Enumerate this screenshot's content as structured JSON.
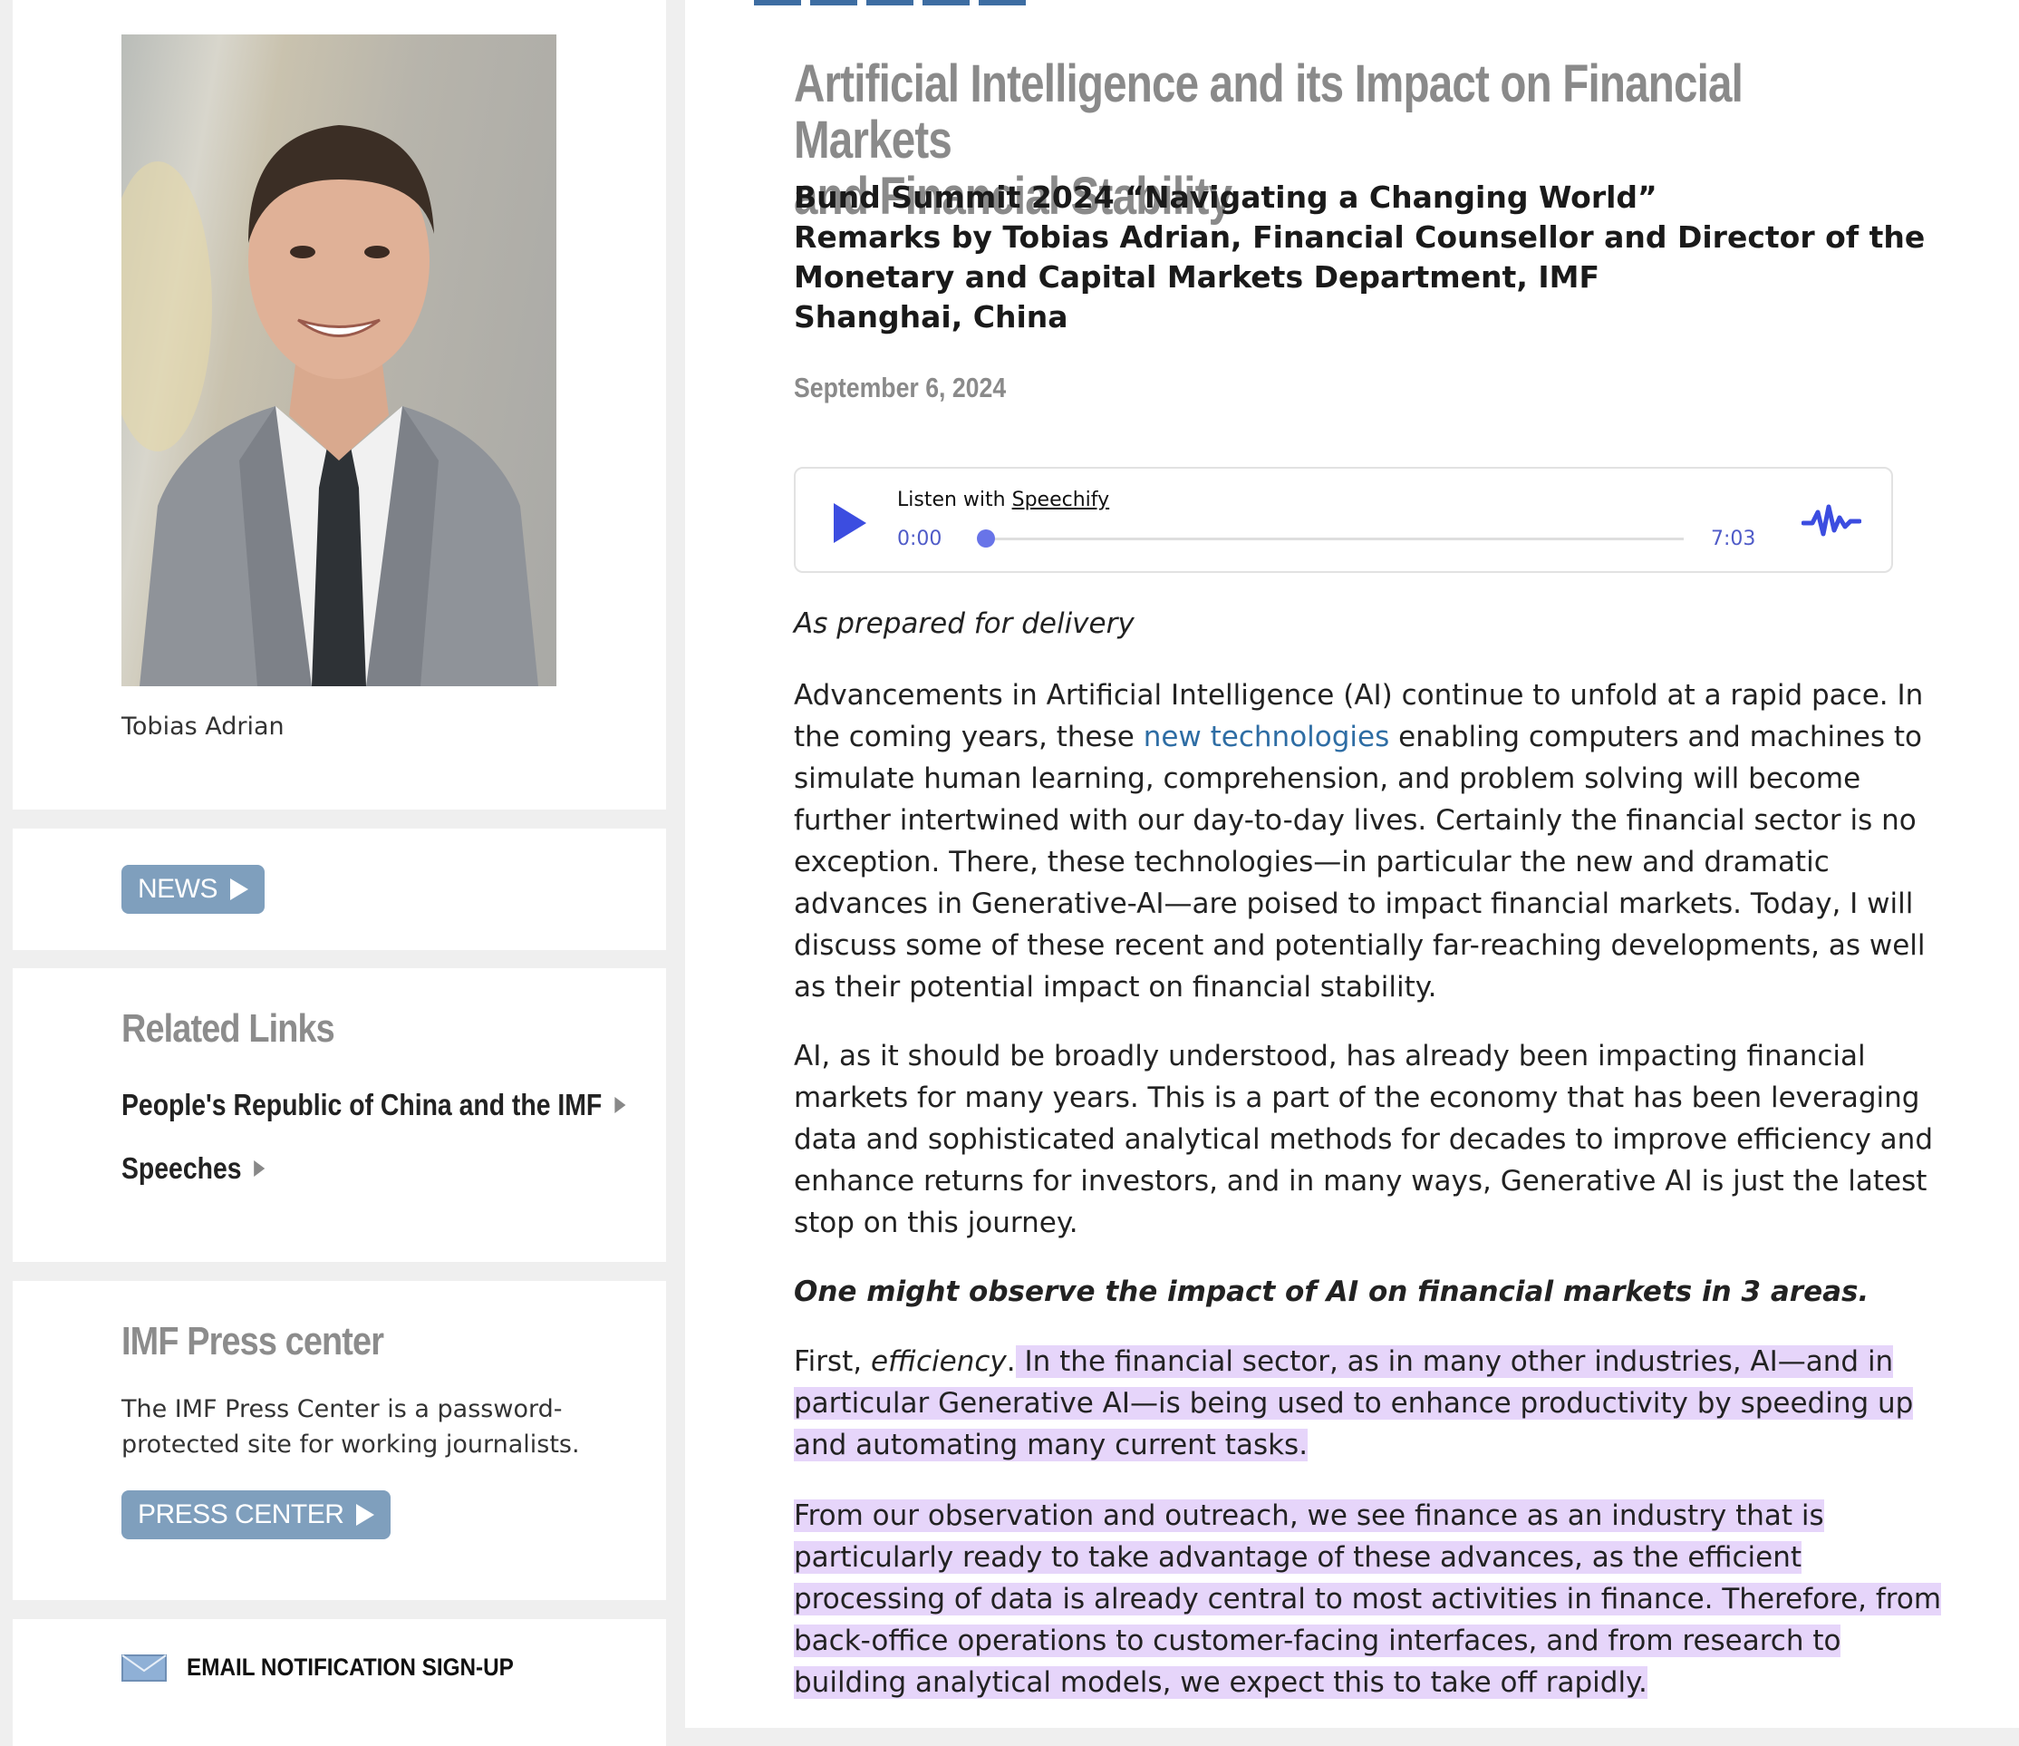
{
  "sidebar": {
    "photo_caption": "Tobias Adrian",
    "news_button": "NEWS",
    "related_links": {
      "title": "Related Links",
      "items": [
        {
          "label": "People's Republic of China and the IMF"
        },
        {
          "label": "Speeches"
        }
      ]
    },
    "press_center": {
      "title": "IMF Press center",
      "description": "The IMF Press Center is a password-protected site for working journalists.",
      "button": "PRESS CENTER"
    },
    "email_signup": "EMAIL NOTIFICATION SIGN-UP"
  },
  "article": {
    "title_line1": "Artificial Intelligence and its Impact on Financial Markets",
    "title_line2": "and Financial Stability",
    "subtitle_lines": [
      "Bund Summit 2024 “Navigating a Changing World”",
      "Remarks by Tobias Adrian, Financial Counsellor and Director of the",
      "Monetary and Capital Markets Department, IMF",
      "Shanghai, China"
    ],
    "date": "September 6, 2024",
    "player": {
      "listen_prefix": "Listen with",
      "listen_brand": "Speechify",
      "time_current": "0:00",
      "time_total": "7:03",
      "progress": 0
    },
    "prepared": "As prepared for delivery",
    "p1_a": "Advancements in Artificial Intelligence (AI) continue to unfold at a rapid pace. In the coming years, these ",
    "p1_link": "new technologies",
    "p1_b": " enabling computers and machines to simulate human learning, comprehension, and problem solving will become further intertwined with our day-to-day lives. Certainly the financial sector is no exception. There, these technologies—in particular the new and dramatic advances in Generative-AI—are poised to impact financial markets. Today, I will discuss some of these recent and potentially far-reaching developments, as well as their potential impact on financial stability.",
    "p2": "AI, as it should be broadly understood, has already been impacting financial markets for many years. This is a part of the economy that has been leveraging data and sophisticated analytical methods for decades to improve efficiency and enhance returns for investors, and in many ways, Generative AI is just the latest stop on this journey.",
    "p3": "One might observe the impact of AI on financial markets in 3 areas.",
    "p4_prefix": "First, ",
    "p4_em": "efficiency",
    "p4_dot": ".",
    "p4_hl": " In the financial sector, as in many other industries, AI—and in particular Generative AI—is being used to enhance productivity by speeding up and automating many current tasks.",
    "p5": "From our observation and outreach, we see finance as an industry that is particularly ready to take advantage of these advances, as the efficient processing of data is already central to most activities in finance. Therefore, from back-office operations to customer-facing interfaces, and from research to building analytical models, we expect this to take off rapidly."
  }
}
